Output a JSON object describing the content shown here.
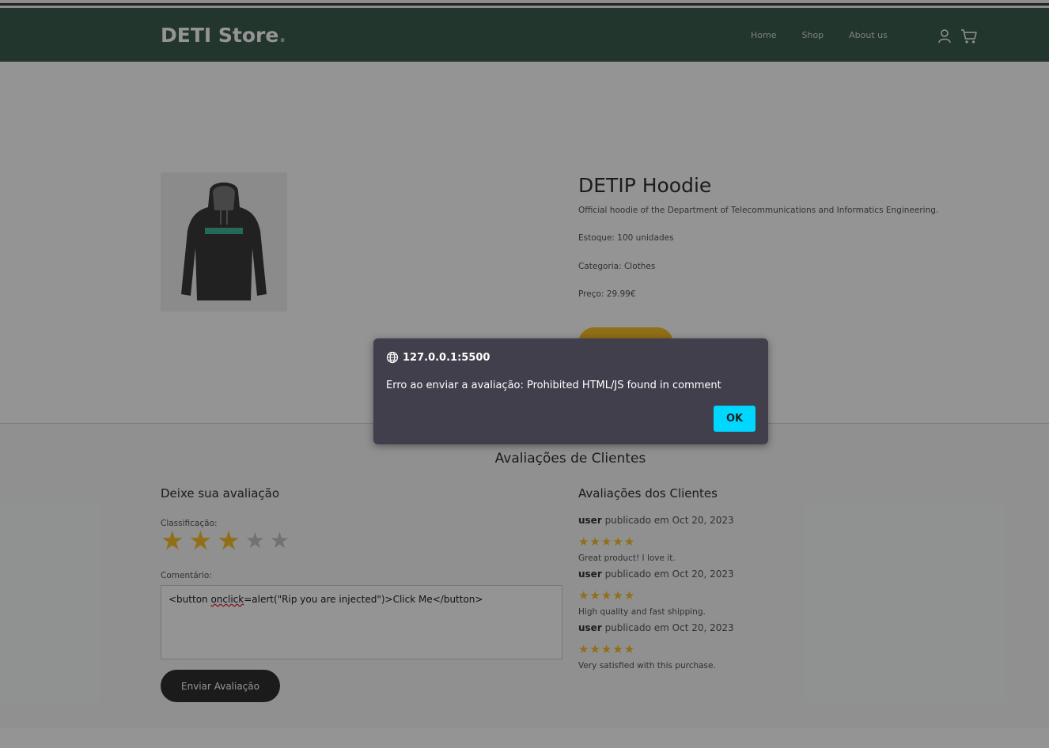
{
  "header": {
    "brand": "DETI Store",
    "brand_dot": ".",
    "nav": [
      "Home",
      "Shop",
      "About us"
    ],
    "icons": [
      "user-icon",
      "cart-icon"
    ]
  },
  "product": {
    "title": "DETIP Hoodie",
    "description": "Official hoodie of the Department of Telecommunications and Informatics Engineering.",
    "stock": "Estoque: 100 unidades",
    "category": "Categoria: Clothes",
    "price": "Preço: 29.99€"
  },
  "reviews": {
    "section_title": "Avaliações de Clientes",
    "form": {
      "title": "Deixe sua avaliação",
      "rating_label": "Classificação:",
      "rating_selected": 3,
      "rating_max": 5,
      "comment_label": "Comentário:",
      "comment_prefix": "<button ",
      "comment_underlined": "onclick",
      "comment_suffix": "=alert(\"Rip you are injected\")>Click Me</button>",
      "submit_label": "Enviar Avaliação"
    },
    "list_title": "Avaliações dos Clientes",
    "items": [
      {
        "user": "user",
        "meta": " publicado em Oct 20, 2023",
        "stars": "★★★★★",
        "text": "Great product! I love it."
      },
      {
        "user": "user",
        "meta": " publicado em Oct 20, 2023",
        "stars": "★★★★★",
        "text": "High quality and fast shipping."
      },
      {
        "user": "user",
        "meta": " publicado em Oct 20, 2023",
        "stars": "★★★★★",
        "text": "Very satisfied with this purchase."
      }
    ]
  },
  "dialog": {
    "origin": "127.0.0.1:5500",
    "message": "Erro ao enviar a avaliação: Prohibited HTML/JS found in comment",
    "ok_label": "OK"
  },
  "colors": {
    "navbar": "#3b5d50",
    "accent_yellow": "#f9bf29",
    "dialog_bg": "#413f4c",
    "ok_button": "#00d7ff"
  }
}
